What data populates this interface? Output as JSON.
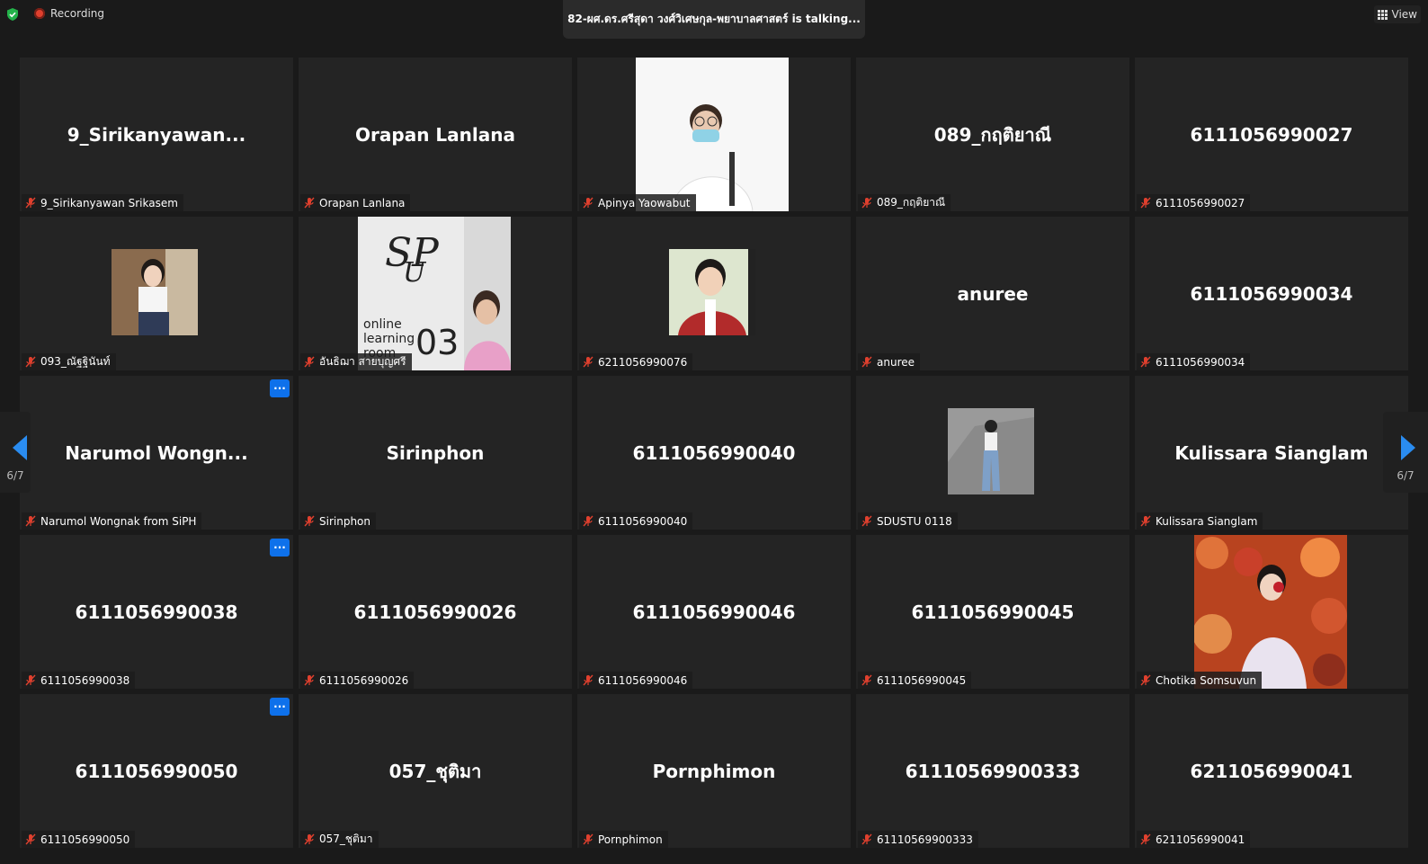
{
  "top": {
    "recording_label": "Recording",
    "talking_text": "82-ผศ.ดร.ศรีสุดา วงศ์วิเศษกุล-พยาบาลศาสตร์ is  talking...",
    "view_label": "View"
  },
  "pager": {
    "left": "6/7",
    "right": "6/7"
  },
  "tiles": [
    {
      "name": "9_Sirikanyawan...",
      "label": "9_Sirikanyawan Srikasem"
    },
    {
      "name": "Orapan Lanlana",
      "label": "Orapan Lanlana"
    },
    {
      "name": "",
      "label": "Apinya Yaowabut",
      "video": "masked-person"
    },
    {
      "name": "089_กฤติยาณี",
      "label": "089_กฤติยาณี"
    },
    {
      "name": "6111056990027",
      "label": "6111056990027"
    },
    {
      "name": "",
      "label": "093_ณัฐฐินันท์",
      "video": "student-photo"
    },
    {
      "name": "",
      "label": "อันธิฌา สายบุญศรี",
      "video": "online-room",
      "overlay": "online learning room",
      "room_no": "03"
    },
    {
      "name": "",
      "label": "6211056990076",
      "video": "grad-photo"
    },
    {
      "name": "anuree",
      "label": "anuree"
    },
    {
      "name": "6111056990034",
      "label": "6111056990034"
    },
    {
      "name": "Narumol  Wongn...",
      "label": "Narumol Wongnak from SiPH",
      "more": true
    },
    {
      "name": "Sirinphon",
      "label": "Sirinphon"
    },
    {
      "name": "6111056990040",
      "label": "6111056990040"
    },
    {
      "name": "",
      "label": "SDUSTU 0118",
      "video": "rock-photo"
    },
    {
      "name": "Kulissara Sianglam",
      "label": "Kulissara Sianglam"
    },
    {
      "name": "6111056990038",
      "label": "6111056990038",
      "more": true
    },
    {
      "name": "6111056990026",
      "label": "6111056990026"
    },
    {
      "name": "6111056990046",
      "label": "6111056990046"
    },
    {
      "name": "6111056990045",
      "label": "6111056990045"
    },
    {
      "name": "",
      "label": "Chotika Somsuvun",
      "video": "leaves-photo"
    },
    {
      "name": "6111056990050",
      "label": "6111056990050",
      "more": true
    },
    {
      "name": "057_ชุติมา",
      "label": "057_ชุติมา"
    },
    {
      "name": "Pornphimon",
      "label": "Pornphimon"
    },
    {
      "name": "61110569900333",
      "label": "61110569900333"
    },
    {
      "name": "6211056990041",
      "label": "6211056990041"
    }
  ],
  "icons": {
    "shield": "shield-check-icon",
    "mic": "mic-muted-icon",
    "more": "more-options-icon",
    "view": "grid-view-icon"
  },
  "colors": {
    "accent": "#0e71eb",
    "muted_mic": "#e0402e",
    "tile_bg": "#242424"
  }
}
